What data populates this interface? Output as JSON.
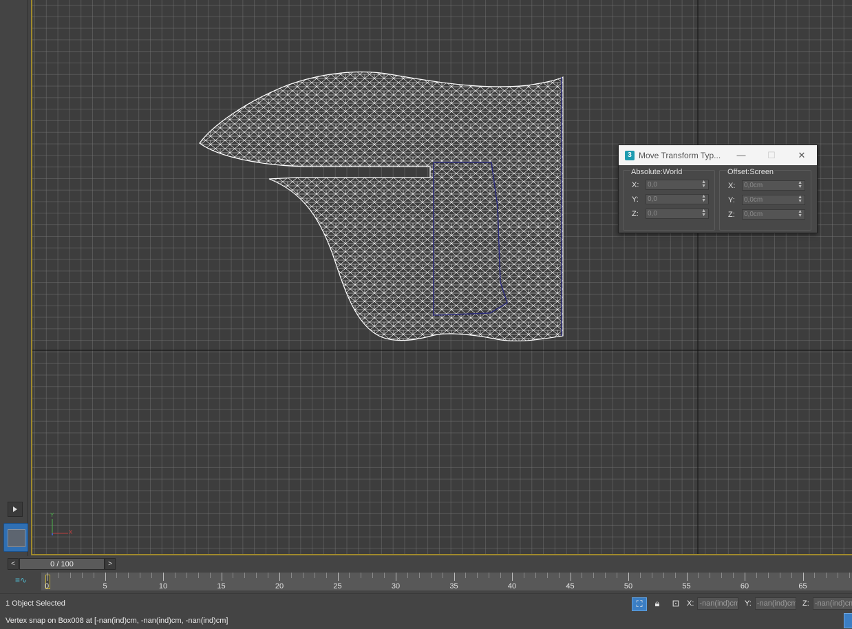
{
  "dialog": {
    "title": "Move Transform Typ...",
    "app_icon_label": "3",
    "minimize_glyph": "—",
    "maximize_glyph": "☐",
    "close_glyph": "✕",
    "absolute": {
      "label": "Absolute:World",
      "fields": [
        {
          "axis": "X:",
          "value": "0,0"
        },
        {
          "axis": "Y:",
          "value": "0,0"
        },
        {
          "axis": "Z:",
          "value": "0,0"
        }
      ]
    },
    "offset": {
      "label": "Offset:Screen",
      "fields": [
        {
          "axis": "X:",
          "value": "0,0cm"
        },
        {
          "axis": "Y:",
          "value": "0,0cm"
        },
        {
          "axis": "Z:",
          "value": "0,0cm"
        }
      ]
    }
  },
  "viewport": {
    "axis_labels": {
      "y": "Y",
      "x": "X"
    },
    "border_color": "#a08a2c",
    "mesh_color": "#ffffff"
  },
  "timeline": {
    "prev": "<",
    "next": ">",
    "frame_display": "0 / 100",
    "ruler_icon": "curve-editor-icon",
    "ruler_labels": [
      "0",
      "5",
      "10",
      "15",
      "20",
      "25",
      "30",
      "35",
      "40",
      "45",
      "50",
      "55",
      "60",
      "65"
    ]
  },
  "status": {
    "selection": "1 Object Selected",
    "prompt": "Vertex snap on Box008 at [-nan(ind)cm, -nan(ind)cm, -nan(ind)cm]",
    "coords": [
      {
        "label": "X:",
        "value": "-nan(ind)cm"
      },
      {
        "label": "Y:",
        "value": "-nan(ind)cm"
      },
      {
        "label": "Z:",
        "value": "-nan(ind)cm"
      }
    ]
  }
}
